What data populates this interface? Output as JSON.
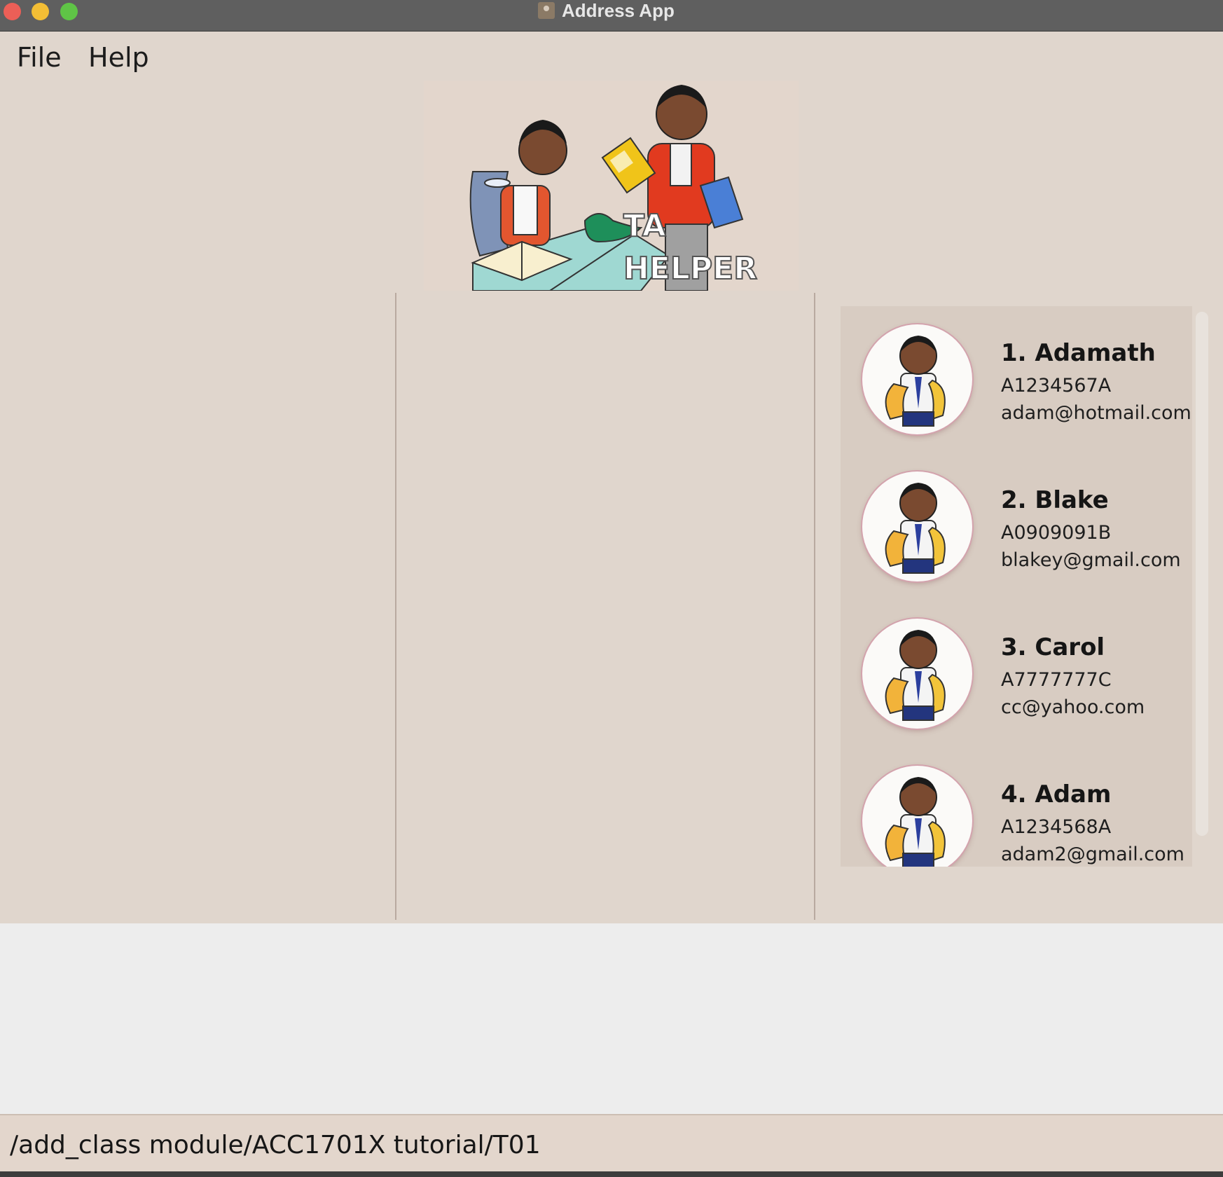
{
  "window": {
    "title": "Address App"
  },
  "menu": {
    "items": [
      {
        "label": "File"
      },
      {
        "label": "Help"
      }
    ]
  },
  "logo": {
    "text_line1": "TA",
    "text_line2": "HELPER"
  },
  "students": [
    {
      "name": "1.  Adamath",
      "id": "A1234567A",
      "email": "adam@hotmail.com"
    },
    {
      "name": "2.  Blake",
      "id": "A0909091B",
      "email": "blakey@gmail.com"
    },
    {
      "name": "3.  Carol",
      "id": "A7777777C",
      "email": "cc@yahoo.com"
    },
    {
      "name": "4.  Adam",
      "id": "A1234568A",
      "email": "adam2@gmail.com"
    }
  ],
  "command": {
    "value": "/add_class module/ACC1701X tutorial/T01"
  },
  "colors": {
    "background": "#e0d6cd",
    "list_background": "#d8ccc2",
    "titlebar": "#5f5f5f"
  }
}
